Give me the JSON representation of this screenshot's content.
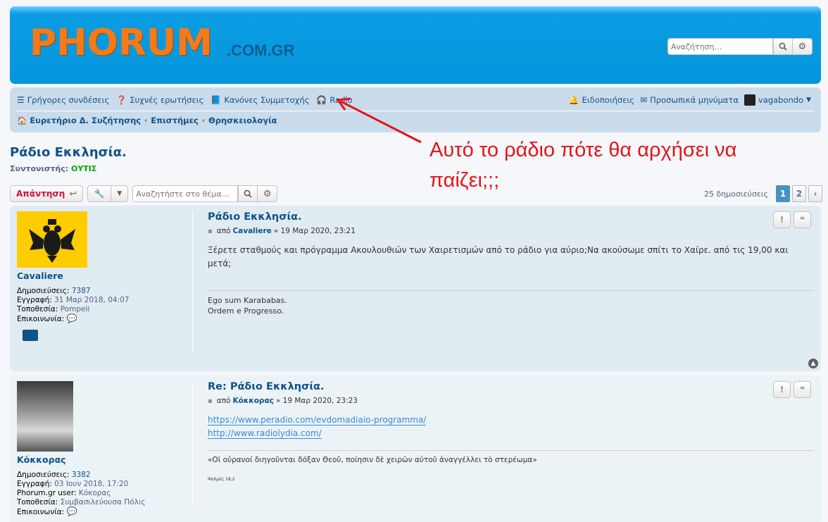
{
  "header": {
    "logo": "PHORUM",
    "logo_suffix": ".COM.GR",
    "search_placeholder": "Αναζήτηση…"
  },
  "nav": {
    "quick_links": "Γρήγορες συνδέσεις",
    "faq": "Συχνές ερωτήσεις",
    "rules": "Κανόνες Συμμετοχής",
    "radio": "Radio",
    "notifications": "Ειδοποιήσεις",
    "messages": "Προσωπικά μηνύματα",
    "username": "vagabondo"
  },
  "breadcrumbs": [
    "Ευρετήριο Δ. Συζήτησης",
    "Επιστήμες",
    "Θρησκειολογία"
  ],
  "annotation": "Αυτό το ράδιο πότε θα αρχήσει να παίζει;;;",
  "topic": {
    "title": "Ράδιο Εκκλησία.",
    "moderator_label": "Συντονιστής:",
    "moderator_name": "ΟΥΤΙΣ"
  },
  "actions": {
    "reply": "Απάντηση",
    "search_placeholder": "Αναζητήστε στο θέμα…",
    "post_count": "25 δημοσιεύσεις",
    "pages": [
      "1",
      "2"
    ]
  },
  "posts": [
    {
      "title": "Ράδιο Εκκλησία.",
      "by": "από",
      "author": "Cavaliere",
      "date": "» 19 Μαρ 2020, 23:21",
      "content": "Ξέρετε σταθμούς και πρόγραμμα Ακουλουθιών των Χαιρετισμών από το ράδιο για αύριο;Να ακούσωμε σπίτι το Χαίρε. από τις 19,00 και μετά;",
      "signature": [
        "Ego sum Karababas.",
        "Ordem e Progresso."
      ],
      "profile": {
        "name": "Cavaliere",
        "posts_label": "Δημοσιεύσεις:",
        "posts": "7387",
        "joined_label": "Εγγραφή:",
        "joined": "31 Μαρ 2018, 04:07",
        "location_label": "Τοποθεσία:",
        "location": "Pompeii",
        "contact_label": "Επικοινωνία:"
      }
    },
    {
      "title": "Re: Ράδιο Εκκλησία.",
      "by": "από",
      "author": "Κόκκορας",
      "date": "» 19 Μαρ 2020, 23:23",
      "links": [
        "https://www.peradio.com/evdomadiaio-programma/",
        "http://www.radiolydia.com/"
      ],
      "signature": [
        "«Οἱ οὐρανοί διηγοῦνται δόξαν Θεοῦ, ποίησιν δὲ χειρῶν αὐτοῦ ἀναγγέλλει τὸ στερέωμα»",
        "Ψαλμός 18,2"
      ],
      "profile": {
        "name": "Κόκκορας",
        "posts_label": "Δημοσιεύσεις:",
        "posts": "3382",
        "joined_label": "Εγγραφή:",
        "joined": "03 Ιουν 2018, 17:20",
        "user_label": "Phorum.gr user:",
        "user": "Κόκορας",
        "location_label": "Τοποθεσία:",
        "location": "Συμβασιλεύουσα Πόλις",
        "contact_label": "Επικοινωνία:"
      }
    }
  ],
  "colors": {
    "brand_blue": "#0596dc",
    "logo_orange": "#f57a18",
    "annotation_red": "#e3141b",
    "link": "#105289"
  }
}
